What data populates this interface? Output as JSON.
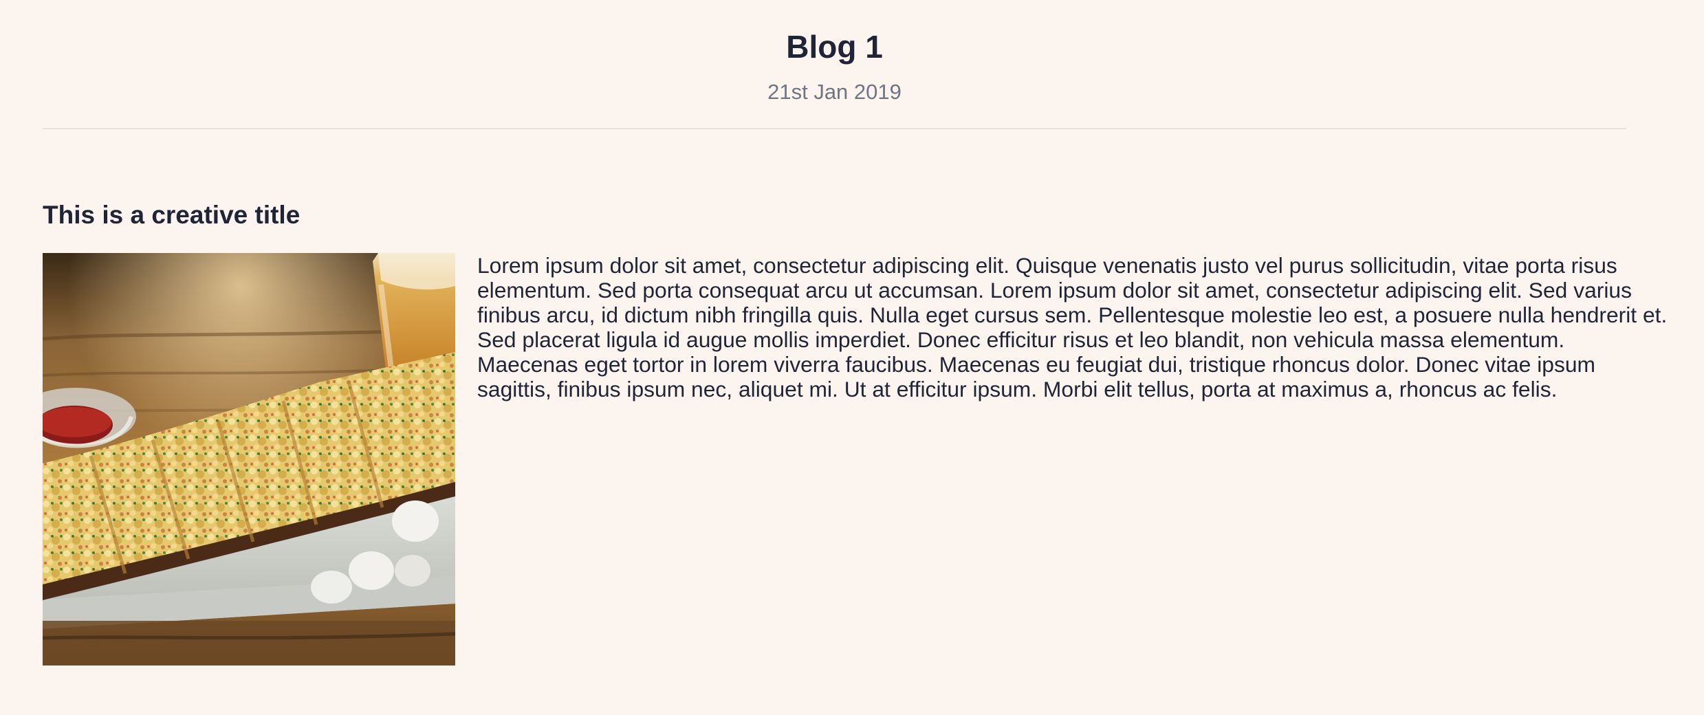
{
  "blog": {
    "title": "Blog 1",
    "date": "21st Jan 2019"
  },
  "post": {
    "title": "This is a creative title",
    "body": "Lorem ipsum dolor sit amet, consectetur adipiscing elit. Quisque venenatis justo vel purus sollicitudin, vitae porta risus elementum. Sed porta consequat arcu ut accumsan. Lorem ipsum dolor sit amet, consectetur adipiscing elit. Sed varius finibus arcu, id dictum nibh fringilla quis. Nulla eget cursus sem. Pellentesque molestie leo est, a posuere nulla hendrerit et. Sed placerat ligula id augue mollis imperdiet. Donec efficitur risus et leo blandit, non vehicula massa elementum. Maecenas eget tortor in lorem viverra faucibus. Maecenas eu feugiat dui, tristique rhoncus dolor. Donec vitae ipsum sagittis, finibus ipsum nec, aliquet mi. Ut at efficitur ipsum. Morbi elit tellus, porta at maximus a, rhoncus ac felis.",
    "image_icon": "food-photo"
  },
  "colors": {
    "background": "#fcf4ee",
    "text": "#1f2437",
    "muted": "#707585",
    "divider": "#e8e1dc"
  }
}
